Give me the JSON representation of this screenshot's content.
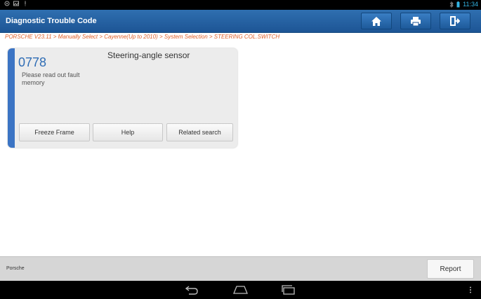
{
  "status_bar": {
    "time": "11:34",
    "left_icons": [
      "location-icon",
      "image-icon",
      "alert-icon"
    ],
    "right_icons": [
      "bluetooth-icon",
      "battery-icon"
    ]
  },
  "header": {
    "title": "Diagnostic Trouble Code",
    "buttons": [
      "home-icon",
      "printer-icon",
      "exit-icon"
    ]
  },
  "breadcrumb": "PORSCHE V23.11 > Manually Select > Cayenne(Up to 2010) > System Selection > STEERING COL.SWITCH",
  "dtc": {
    "code": "0778",
    "title": "Steering-angle sensor",
    "message": "Please read out fault memory",
    "buttons": {
      "freeze_frame": "Freeze Frame",
      "help": "Help",
      "related_search": "Related search"
    }
  },
  "footer": {
    "brand": "Porsche",
    "report_label": "Report"
  },
  "colors": {
    "accent": "#3b74c4",
    "breadcrumb": "#e0602a",
    "title_bar": "#1d5595"
  }
}
